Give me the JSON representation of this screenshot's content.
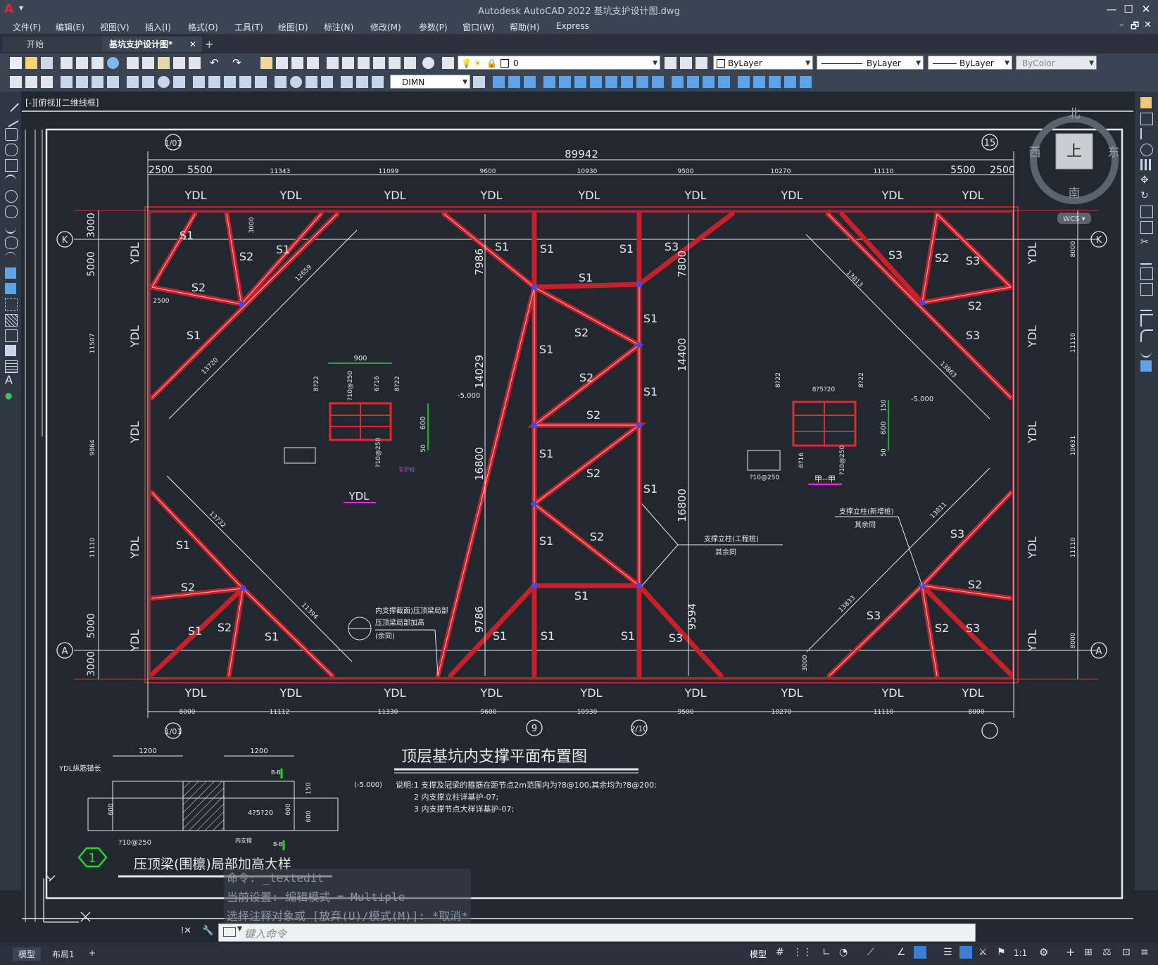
{
  "app": {
    "title": "Autodesk AutoCAD 2022    基坑支护设计图.dwg",
    "logo": "A",
    "window_buttons": [
      "—",
      "☐",
      "✕"
    ],
    "doc_window_buttons": [
      "–",
      "🗗",
      "✕"
    ]
  },
  "menu": [
    "文件(F)",
    "编辑(E)",
    "视图(V)",
    "插入(I)",
    "格式(O)",
    "工具(T)",
    "绘图(D)",
    "标注(N)",
    "修改(M)",
    "参数(P)",
    "窗口(W)",
    "帮助(H)",
    "Express"
  ],
  "file_tabs": {
    "start": "开始",
    "active": "基坑支护设计图*",
    "close": "✕",
    "add": "+"
  },
  "toolbar": {
    "layer_value": "0",
    "color_value": "ByLayer",
    "linetype_value": "ByLayer",
    "lineweight_value": "ByLayer",
    "plotstyle_value": "ByColor",
    "dimstyle_value": "DIMN"
  },
  "viewport": {
    "label": "[-][俯视][二维线框]"
  },
  "viewcube": {
    "north": "北",
    "south": "南",
    "east": "东",
    "west": "西",
    "top_face": "上",
    "wcs": "WCS ▾"
  },
  "drawing": {
    "total_dim": "89942",
    "top_dims": [
      "2500",
      "5500",
      "11343",
      "11099",
      "9600",
      "10930",
      "9500",
      "10270",
      "11110",
      "5500",
      "2500"
    ],
    "bottom_dims": [
      "8000",
      "11112",
      "11330",
      "9600",
      "10930",
      "9500",
      "10270",
      "11110",
      "8000"
    ],
    "left_dims": [
      "3000",
      "5000",
      "11507",
      "9864",
      "11110",
      "5000",
      "3000"
    ],
    "right_dims": [
      "8000",
      "11110",
      "10631",
      "11110",
      "8000"
    ],
    "grid_labels": {
      "k": "K",
      "a": "A",
      "top_left": "1/01",
      "top_right": "15",
      "bottom_left": "1/01",
      "b9": "9",
      "b210": "2/10"
    },
    "beam_label": "YDL",
    "strut_labels": {
      "s1": "S1",
      "s2": "S2",
      "s3": "S3"
    },
    "inner_dims": {
      "d7986": "7986",
      "d14029": "14029",
      "d16800a": "16800",
      "d9786": "9786",
      "d7800": "7800",
      "d14400": "14400",
      "d16800b": "16800",
      "d9594": "9594",
      "d3000a": "3000",
      "d3000b": "3000",
      "d2500": "2500"
    },
    "diag_dims": [
      "12659",
      "13720",
      "13732",
      "11394",
      "13813",
      "13863",
      "13811",
      "13833"
    ],
    "section_ydl": {
      "width": "900",
      "h1": "8?22",
      "h2": "?10@250",
      "h3": "6?16",
      "h4": "8?22",
      "depth": "600",
      "small": "50",
      "bottom": "?10@250",
      "elev": "-5.000",
      "name": "YDL",
      "tag": "支护桩"
    },
    "section_jia": {
      "top": "8?5?20",
      "h1": "8?22",
      "h2": "8?22",
      "depth": "600",
      "top150": "150",
      "small": "50",
      "elev": "-5.000",
      "b1": "6?16",
      "b2": "?10@250",
      "left": "?10@250",
      "name": "甲--甲"
    },
    "annotations": {
      "column_note": "支撑立柱(工程桩)",
      "column_note2": "其余同",
      "new_col_note": "支撑立柱(新增桩)",
      "new_col_note2": "其余同",
      "pressure_note1": "内支撑截面)压顶梁局部",
      "pressure_note2": "压顶梁局部加高",
      "pressure_note3": "(余同)"
    },
    "main_title": "顶层基坑内支撑平面布置图",
    "notes": [
      "说明:1 支撑及冠梁的箍筋在距节点2m范围内为?8@100,其余均为?8@200;",
      "2 内支撑立柱详基护-07;",
      "3 内支撑节点大样详基护-07;"
    ],
    "detail": {
      "number": "1",
      "title": "压顶梁(围檩)局部加高大样",
      "w1": "1200",
      "w2": "1200",
      "ydl_label": "YDL纵筋锚长",
      "h600a": "600",
      "h600b": "600",
      "h600c": "600",
      "h150": "150",
      "rebar": "4?5?20",
      "stir": "?10@250",
      "elev": "(-5.000)",
      "tag_a": "B-B",
      "tag_b": "B-B",
      "support": "内支撑"
    }
  },
  "command": {
    "history": [
      "命令: _textedit",
      "当前设置: 编辑模式 = Multiple",
      "选择注释对象或 [放弃(U)/模式(M)]: *取消*"
    ],
    "placeholder": "键入命令"
  },
  "status": {
    "model_tab": "模型",
    "layout_tab": "布局1",
    "add_tab": "+",
    "model_button": "模型",
    "scale": "1:1"
  },
  "colors": {
    "background": "#212830",
    "strut": "#c8202a",
    "ydl_red": "#e8262d",
    "dim": "#e8e8e8",
    "green": "#1fdc1f",
    "magenta": "#e030e0",
    "blue_node": "#3a4cff"
  }
}
